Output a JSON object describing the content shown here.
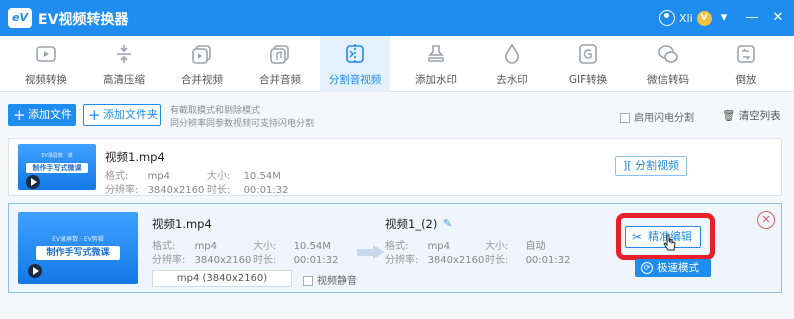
{
  "app": {
    "logo_text": "eV",
    "title": "EV视频转换器"
  },
  "user": {
    "name": "Xli",
    "vip_badge": "V"
  },
  "window_controls": {
    "dropdown": "▾",
    "minimize": "—",
    "close": "✕"
  },
  "toolbar": {
    "tools": [
      {
        "label": "视频转换",
        "icon": "video-convert-icon"
      },
      {
        "label": "高清压缩",
        "icon": "compress-icon"
      },
      {
        "label": "合并视频",
        "icon": "merge-video-icon"
      },
      {
        "label": "合并音频",
        "icon": "merge-audio-icon"
      },
      {
        "label": "分割音视频",
        "icon": "split-icon",
        "active": true
      },
      {
        "label": "添加水印",
        "icon": "stamp-icon"
      },
      {
        "label": "去水印",
        "icon": "drop-icon"
      },
      {
        "label": "GIF转换",
        "icon": "gif-icon"
      },
      {
        "label": "微信转码",
        "icon": "wechat-icon"
      },
      {
        "label": "倒放",
        "icon": "reverse-icon"
      }
    ],
    "active_color": "#1f8cf0"
  },
  "actions": {
    "add_file": "添加文件",
    "add_folder": "添加文件夹",
    "hint_line1": "有截取模式和剔除模式",
    "hint_line2": "同分辨率同参数视频可支持闪电分割",
    "flash_split": "启用闪电分割",
    "clear_list": "清空列表"
  },
  "files": [
    {
      "name": "视频1.mp4",
      "format_label": "格式:",
      "format": "mp4",
      "size_label": "大小:",
      "size": "10.54M",
      "res_label": "分辨率:",
      "resolution": "3840x2160",
      "dur_label": "时长:",
      "duration": "00:01:32",
      "split_button": "分割视频",
      "thumb_banner": "制作手写式微课",
      "thumb_sub": "EV录屏数 · 课"
    },
    {
      "name": "视频1.mp4",
      "format_label": "格式:",
      "format": "mp4",
      "size_label": "大小:",
      "size": "10.54M",
      "res_label": "分辨率:",
      "resolution": "3840x2160",
      "dur_label": "时长:",
      "duration": "00:01:32",
      "thumb_title": "EV录屏数 · EV剪辑",
      "thumb_banner": "制作手写式微课",
      "output": {
        "name": "视频1_(2)",
        "format_label": "格式:",
        "format": "mp4",
        "size_label": "大小:",
        "size": "自动",
        "res_label": "分辨率:",
        "resolution": "3840x2160",
        "dur_label": "时长:",
        "duration": "00:01:32"
      },
      "format_select": "mp4 (3840x2160)",
      "mute_label": "视频静音",
      "precise_edit": "精准编辑",
      "fast_mode": "极速模式",
      "remove": "✕"
    }
  ]
}
